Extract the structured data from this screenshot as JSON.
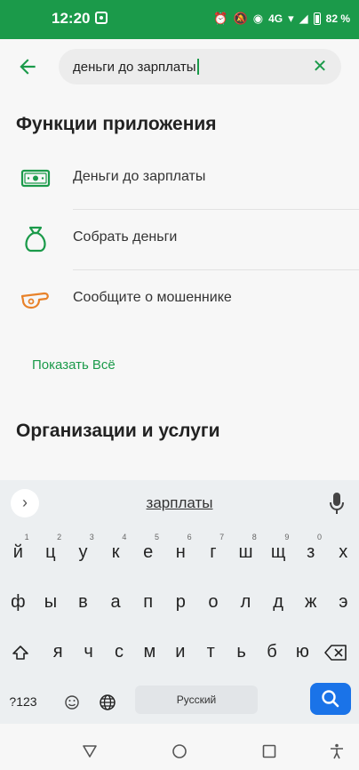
{
  "status_bar": {
    "time": "12:20",
    "network": "4G",
    "battery_text": "82 %",
    "bg_color": "#1b9a4a"
  },
  "search": {
    "query": "деньги до зарплаты",
    "clear_icon": "close-icon",
    "back_icon": "arrow-back-icon"
  },
  "features": {
    "title": "Функции приложения",
    "items": [
      {
        "label": "Деньги до зарплаты",
        "icon": "banknote-icon"
      },
      {
        "label": "Собрать деньги",
        "icon": "money-bag-icon"
      },
      {
        "label": "Сообщите о мошеннике",
        "icon": "whistle-icon"
      }
    ],
    "show_all": "Показать Всё"
  },
  "organizations": {
    "title": "Организации и услуги"
  },
  "keyboard": {
    "suggestion": "зарплаты",
    "row1": [
      "й",
      "ц",
      "у",
      "к",
      "е",
      "н",
      "г",
      "ш",
      "щ",
      "з",
      "х"
    ],
    "row1_hints": [
      "1",
      "2",
      "3",
      "4",
      "5",
      "6",
      "7",
      "8",
      "9",
      "0",
      ""
    ],
    "row2": [
      "ф",
      "ы",
      "в",
      "а",
      "п",
      "р",
      "о",
      "л",
      "д",
      "ж",
      "э"
    ],
    "row3": [
      "я",
      "ч",
      "с",
      "м",
      "и",
      "т",
      "ь",
      "б",
      "ю"
    ],
    "symbols_label": "?123",
    "space_label": "Русский",
    "accent_color": "#1a73e8"
  }
}
